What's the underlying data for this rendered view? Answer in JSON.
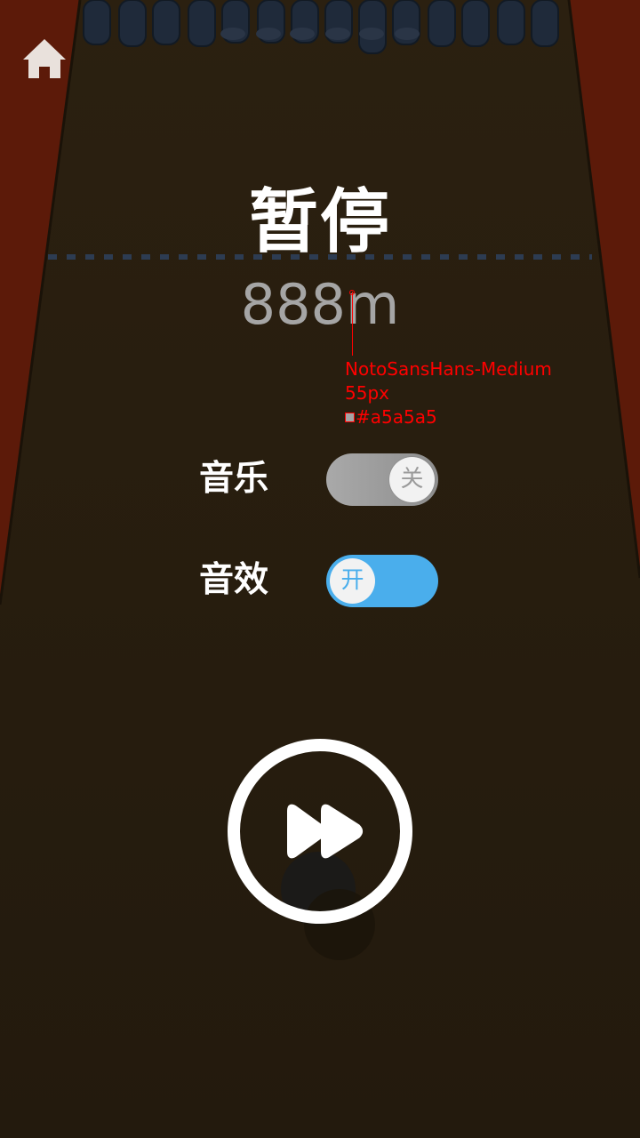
{
  "game": {
    "pause_title": "暂停",
    "distance": "888m"
  },
  "annotation": {
    "font": "NotoSansHans-Medium",
    "size": "55px",
    "color": "#a5a5a5"
  },
  "settings": {
    "music": {
      "label": "音乐",
      "state": "关",
      "enabled": false
    },
    "sfx": {
      "label": "音效",
      "state": "开",
      "enabled": true
    }
  },
  "icons": {
    "home": "home-icon",
    "resume": "fast-forward-icon"
  },
  "colors": {
    "background_floor": "#231a0f",
    "background_edges": "#6a1a08",
    "toggle_on": "#4aaeec",
    "toggle_off": "#9a9a9a",
    "distance_text": "#a5a5a5",
    "annotation": "#ff0000"
  }
}
